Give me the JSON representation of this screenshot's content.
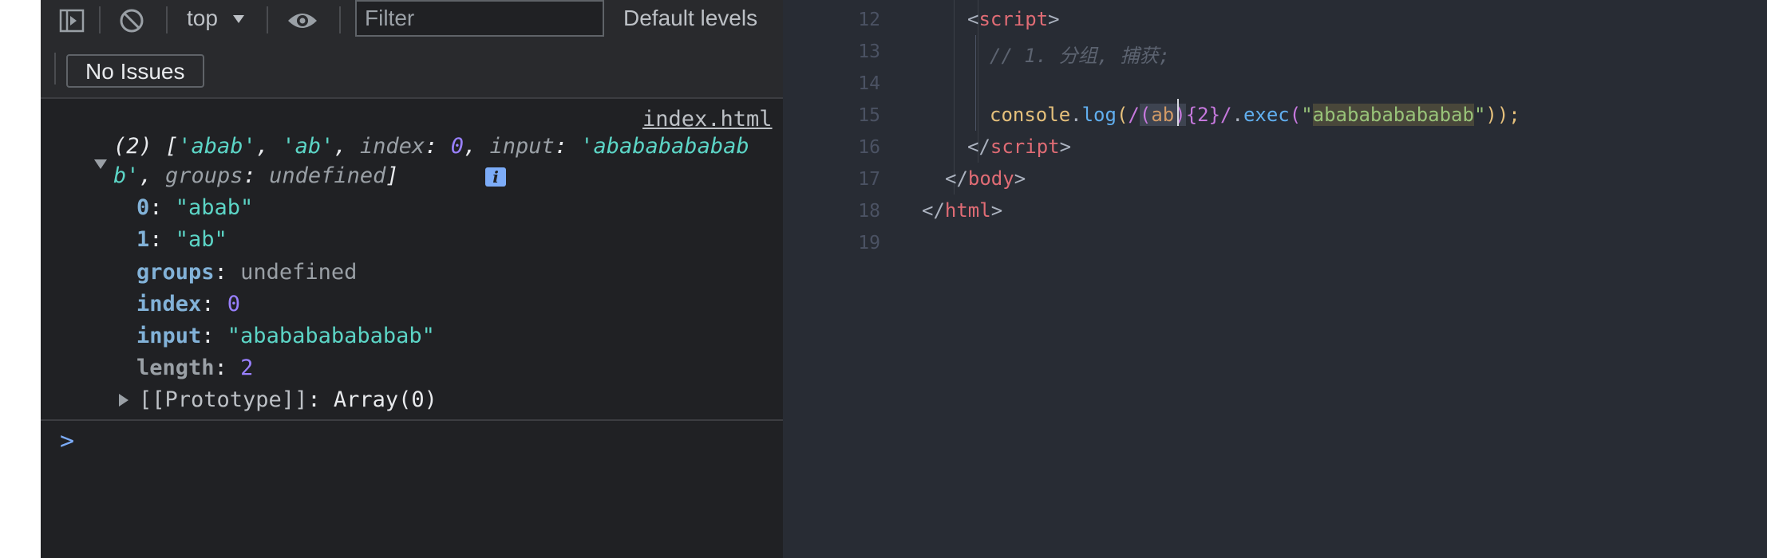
{
  "toolbar": {
    "context": "top",
    "filter_placeholder": "Filter",
    "levels": "Default levels",
    "issues": "No Issues",
    "icons": [
      "sidebar-toggle-icon",
      "clear-console-icon",
      "chevron-down-icon",
      "eye-icon"
    ]
  },
  "console": {
    "source_link": "index.html",
    "summary_line1": {
      "count": "(2) [",
      "item0": "'abab'",
      "comma1": ", ",
      "item1": "'ab'",
      "comma2": ", ",
      "index_key": "index",
      "colon1": ": ",
      "index_val": "0",
      "comma3": ", ",
      "input_key": "input",
      "colon2": ": ",
      "input_val": "'abababababab"
    },
    "summary_line2": {
      "input_tail": "b'",
      "comma": ", ",
      "groups_key": "groups",
      "colon": ": ",
      "groups_val": "undefined",
      "close": "]"
    },
    "info_badge": "i",
    "props": [
      {
        "key": "0",
        "sep": ": ",
        "value": "\"abab\""
      },
      {
        "key": "1",
        "sep": ": ",
        "value": "\"ab\""
      },
      {
        "key": "groups",
        "sep": ": ",
        "value": "undefined"
      },
      {
        "key": "index",
        "sep": ": ",
        "value": "0"
      },
      {
        "key": "input",
        "sep": ": ",
        "value": "\"ababababababab\""
      },
      {
        "key": "length",
        "sep": ": ",
        "value": "2"
      }
    ],
    "prototype": {
      "key": "[[Prototype]]",
      "sep": ": ",
      "value": "Array(0)"
    },
    "prompt": ">"
  },
  "editor": {
    "line_numbers": [
      "12",
      "13",
      "14",
      "15",
      "16",
      "17",
      "18",
      "19"
    ],
    "l12": {
      "open": "<",
      "tag": "script",
      "close": ">"
    },
    "l13": {
      "comment": "// 1. 分组, 捕获;"
    },
    "l15": {
      "obj": "console",
      "dot": ".",
      "fn": "log",
      "paren_open": "(",
      "rx_start": "/",
      "group_open": "(",
      "group_body": "ab",
      "group_close": ")",
      "quant": "{2}",
      "rx_end": "/",
      "dot2": ".",
      "exec": "exec",
      "paren_open2": "(",
      "quote1": "\"",
      "str": "ababababababab",
      "quote2": "\"",
      "tail": "));"
    },
    "l16": {
      "open": "</",
      "tag": "script",
      "close": ">"
    },
    "l17": {
      "open": "</",
      "tag": "body",
      "close": ">"
    },
    "l18": {
      "open": "</",
      "tag": "html",
      "close": ">"
    },
    "colors": {
      "background": "#282c34",
      "tag": "#e06c75",
      "string": "#98c379",
      "function": "#61afef"
    }
  },
  "colors": {
    "console_bg": "#202124",
    "toolbar_bg": "#292a2d",
    "string": "#5cd5c6",
    "number": "#9980ff",
    "accent": "#7cacf8"
  }
}
